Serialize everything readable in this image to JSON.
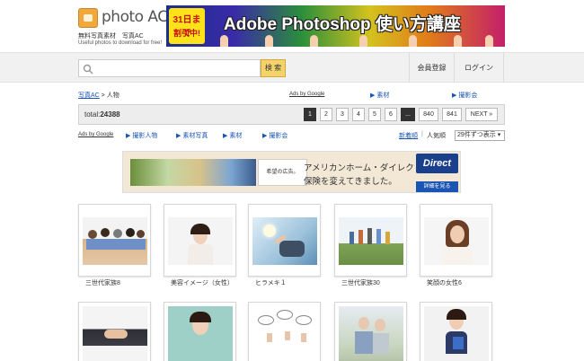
{
  "header": {
    "logo_text": "photo AC",
    "logo_sub1": "無料写真素材　写真AC",
    "logo_sub2": "Useful photos to download for free!",
    "banner": {
      "badge_top": "31日まで",
      "badge_bottom": "割引中!",
      "title": "Adobe Photoshop 使い方講座"
    }
  },
  "search": {
    "placeholder": "",
    "button_label": "検 索"
  },
  "nav": {
    "register_label": "会員登録",
    "login_label": "ログイン"
  },
  "breadcrumb": {
    "home": "写真AC",
    "separator": " > ",
    "current": "人物"
  },
  "ads_row1": {
    "ads_by_google": "Ads by Google",
    "links": [
      "▶ 素材",
      "▶ 撮影会"
    ]
  },
  "pager": {
    "total_label": "total:",
    "total_value": "24388",
    "pages": [
      "1",
      "2",
      "3",
      "4",
      "5",
      "6",
      "...",
      "840",
      "841",
      "NEXT »"
    ],
    "current_page": "1"
  },
  "ads_row2": {
    "ads_by_google": "Ads by Google",
    "links": [
      "▶ 撮影人物",
      "▶ 素材写真",
      "▶ 素材",
      "▶ 撮影会"
    ]
  },
  "sort": {
    "newest": "新着順",
    "separator": "|",
    "popular": "人気順",
    "per_page": "29件ずつ表示 ▾"
  },
  "ad_box": {
    "small_ad_text": "希望の広告。",
    "line1": "アメリカンホーム・ダイレクトは",
    "line2": "保険を変えてきました。",
    "logo": "Direct",
    "detail_button": "詳細を見る"
  },
  "photos": [
    {
      "caption": "三世代家族8"
    },
    {
      "caption": "美容イメージ（女性）"
    },
    {
      "caption": "ヒラメキ１"
    },
    {
      "caption": "三世代家族30"
    },
    {
      "caption": "笑顔の女性6"
    },
    {
      "caption": ""
    },
    {
      "caption": ""
    },
    {
      "caption": ""
    },
    {
      "caption": ""
    },
    {
      "caption": ""
    }
  ]
}
